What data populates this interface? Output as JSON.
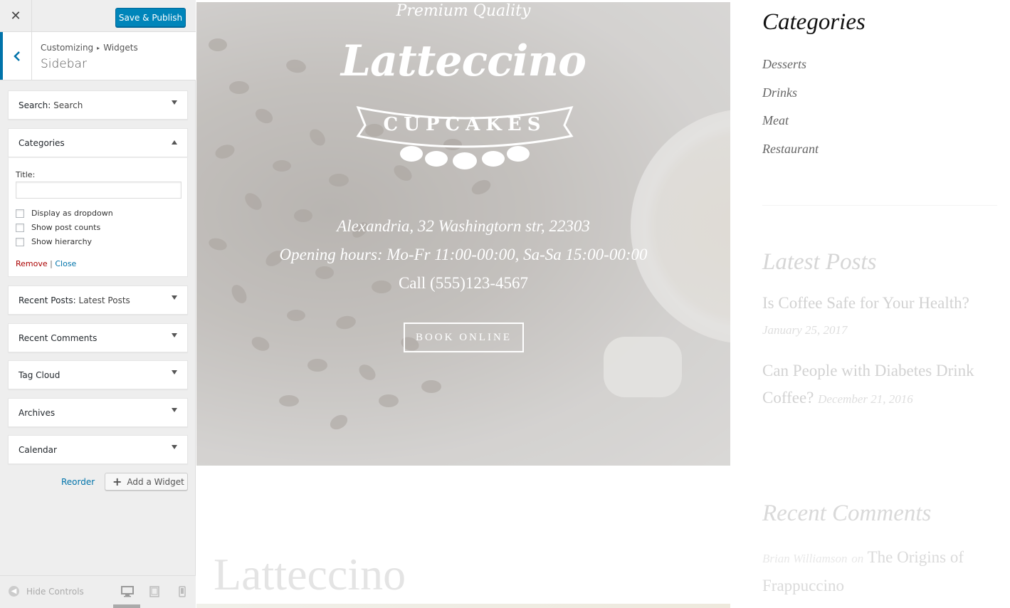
{
  "topbar": {
    "close_icon": "✕",
    "publish_label": "Save & Publish"
  },
  "section": {
    "breadcrumb": [
      "Customizing",
      "Widgets"
    ],
    "title": "Sidebar"
  },
  "widgets": [
    {
      "name": "Search",
      "subtitle": "Search"
    },
    {
      "name": "Categories",
      "subtitle": ""
    },
    {
      "name": "Recent Posts",
      "subtitle": "Latest Posts"
    },
    {
      "name": "Recent Comments",
      "subtitle": ""
    },
    {
      "name": "Tag Cloud",
      "subtitle": ""
    },
    {
      "name": "Archives",
      "subtitle": ""
    },
    {
      "name": "Calendar",
      "subtitle": ""
    }
  ],
  "categories_form": {
    "title_label": "Title:",
    "title_value": "",
    "options": [
      "Display as dropdown",
      "Show post counts",
      "Show hierarchy"
    ],
    "remove_label": "Remove",
    "separator": "|",
    "close_label": "Close"
  },
  "actions": {
    "reorder_label": "Reorder",
    "add_widget_label": "Add a Widget"
  },
  "footer": {
    "hide_controls_label": "Hide Controls",
    "devices": [
      "desktop-icon",
      "tablet-icon",
      "mobile-icon"
    ]
  },
  "hero": {
    "tagline": "Premium Quality",
    "brand": "Latteccino",
    "ribbon": "CUPCAKES",
    "address": "Alexandria, 32 Washingtorn str, 22303",
    "hours": "Opening hours: Mo-Fr 11:00-00:00, Sa-Sa 15:00-00:00",
    "phone": "Call (555)123-4567",
    "book_label": "BOOK ONLINE"
  },
  "site_title": "Latteccino",
  "sidebar_preview": {
    "categories_heading": "Categories",
    "categories": [
      "Desserts",
      "Drinks",
      "Meat",
      "Restaurant"
    ],
    "latest_heading": "Latest Posts",
    "posts": [
      {
        "title": "Is Coffee Safe for Your Health?",
        "date": "January 25, 2017"
      },
      {
        "title": "Can People with Diabetes Drink Coffee?",
        "date": "December 21, 2016"
      }
    ],
    "comments_heading": "Recent Comments",
    "comment": {
      "author": "Brian Williamson",
      "on": "on",
      "post": "The Origins of Frappuccino"
    }
  },
  "colors": {
    "accent": "#0085ba",
    "link": "#0073aa",
    "remove": "#aa0000"
  }
}
